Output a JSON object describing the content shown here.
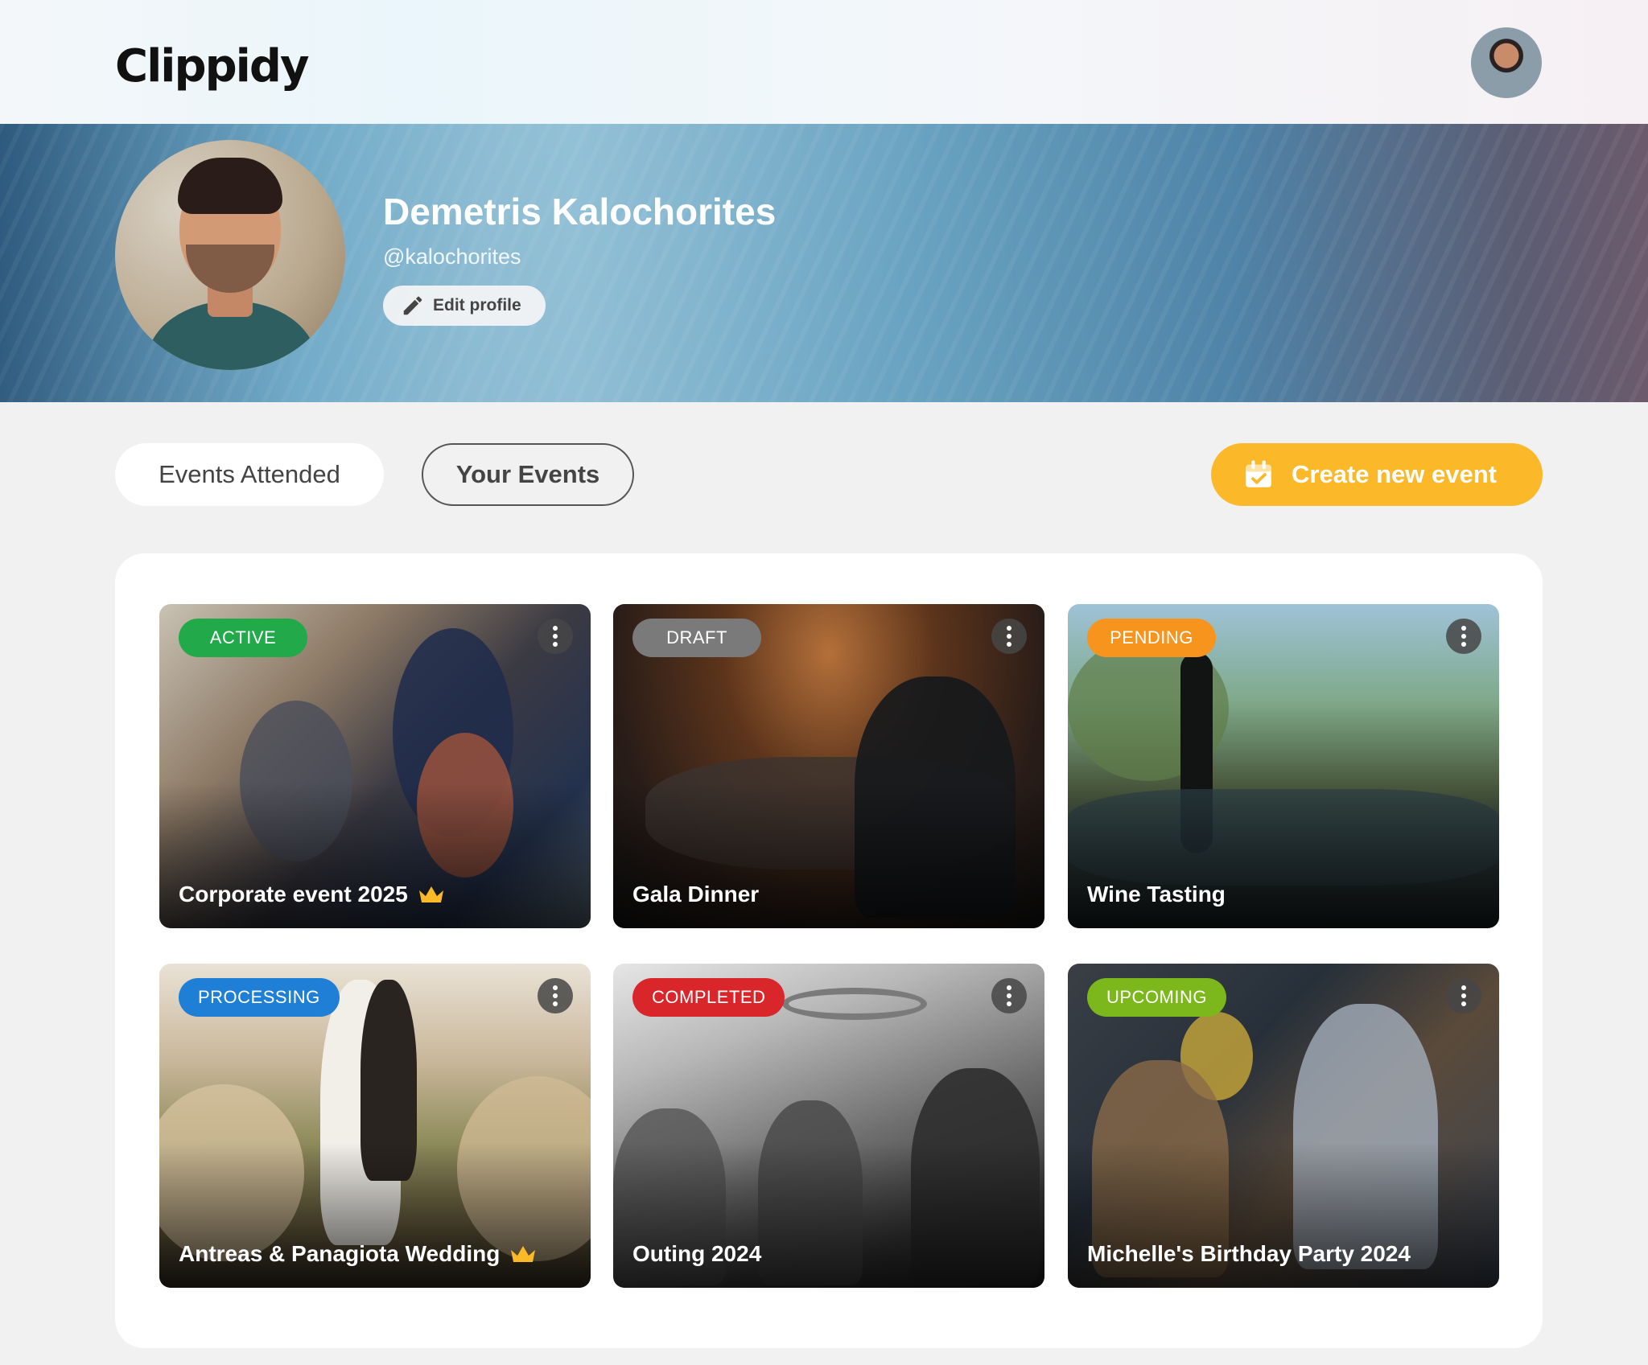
{
  "app": {
    "logo": "Clippidy"
  },
  "profile": {
    "name": "Demetris Kalochorites",
    "handle": "@kalochorites",
    "edit_label": "Edit profile"
  },
  "tabs": [
    {
      "label": "Events Attended",
      "active": false
    },
    {
      "label": "Your Events",
      "active": true
    }
  ],
  "actions": {
    "create_label": "Create new event"
  },
  "colors": {
    "accent": "#fbb92a",
    "active": "#21a94a",
    "draft": "#7a7a7a",
    "pending": "#f7941d",
    "processing": "#1f7fd6",
    "completed": "#d9262b",
    "upcoming": "#7cb81c"
  },
  "events": [
    {
      "title": "Corporate event 2025",
      "status": "ACTIVE",
      "premium": true
    },
    {
      "title": "Gala Dinner",
      "status": "DRAFT",
      "premium": false
    },
    {
      "title": "Wine Tasting",
      "status": "PENDING",
      "premium": false
    },
    {
      "title": "Antreas & Panagiota Wedding",
      "status": "PROCESSING",
      "premium": true
    },
    {
      "title": "Outing 2024",
      "status": "COMPLETED",
      "premium": false
    },
    {
      "title": "Michelle's Birthday Party 2024",
      "status": "UPCOMING",
      "premium": false
    }
  ],
  "icons": [
    "pencil-icon",
    "calendar-check-icon",
    "more-vertical-icon",
    "crown-icon"
  ]
}
